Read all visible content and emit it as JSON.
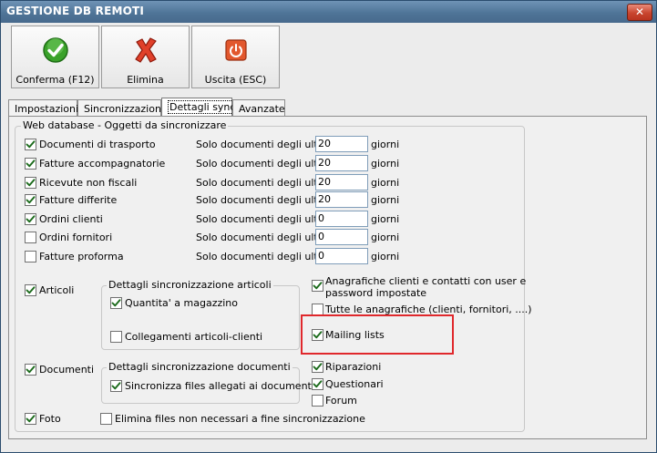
{
  "window": {
    "title": "GESTIONE DB REMOTI",
    "close_glyph": "✕"
  },
  "toolbar": [
    {
      "label": "Conferma (F12)",
      "icon": "green-check-icon"
    },
    {
      "label": "Elimina",
      "icon": "red-x-icon"
    },
    {
      "label": "Uscita (ESC)",
      "icon": "exit-power-icon"
    }
  ],
  "tabs": [
    {
      "label": "Impostazioni",
      "active": false
    },
    {
      "label": "Sincronizzazione",
      "active": false
    },
    {
      "label": "Dettagli sync",
      "active": true
    },
    {
      "label": "Avanzate",
      "active": false
    }
  ],
  "main_group": {
    "legend": "Web database - Oggetti da sincronizzare"
  },
  "doc_rows": [
    {
      "label": "Documenti di trasporto",
      "checked": true,
      "prefix": "Solo documenti degli ultimi",
      "value": "20",
      "suffix": "giorni"
    },
    {
      "label": "Fatture accompagnatorie",
      "checked": true,
      "prefix": "Solo documenti degli ultimi",
      "value": "20",
      "suffix": "giorni"
    },
    {
      "label": "Ricevute non fiscali",
      "checked": true,
      "prefix": "Solo documenti degli ultimi",
      "value": "20",
      "suffix": "giorni"
    },
    {
      "label": "Fatture differite",
      "checked": true,
      "prefix": "Solo documenti degli ultimi",
      "value": "20",
      "suffix": "giorni"
    },
    {
      "label": "Ordini clienti",
      "checked": true,
      "prefix": "Solo documenti degli ultimi",
      "value": "0",
      "suffix": "giorni"
    },
    {
      "label": "Ordini fornitori",
      "checked": false,
      "prefix": "Solo documenti degli ultimi",
      "value": "0",
      "suffix": "giorni"
    },
    {
      "label": "Fatture proforma",
      "checked": false,
      "prefix": "Solo documenti degli ultimi",
      "value": "0",
      "suffix": "giorni"
    }
  ],
  "articoli": {
    "label": "Articoli",
    "checked": true,
    "group_legend": "Dettagli sincronizzazione articoli",
    "quantita": {
      "label": "Quantita' a magazzino",
      "checked": true
    },
    "collegamenti": {
      "label": "Collegamenti articoli-clienti",
      "checked": false
    }
  },
  "anagrafiche": {
    "user": {
      "label_line1": "Anagrafiche clienti e contatti con user e",
      "label_line2": "password impostate",
      "checked": true
    },
    "tutte": {
      "label": "Tutte le anagrafiche (clienti, fornitori, ....)",
      "checked": false
    },
    "mailing": {
      "label": "Mailing lists",
      "checked": true
    }
  },
  "documenti": {
    "label": "Documenti",
    "checked": true,
    "group_legend": "Dettagli sincronizzazione documenti",
    "allegati": {
      "label": "Sincronizza files allegati ai documenti",
      "checked": true
    }
  },
  "extra": {
    "riparazioni": {
      "label": "Riparazioni",
      "checked": true
    },
    "questionari": {
      "label": "Questionari",
      "checked": true
    },
    "forum": {
      "label": "Forum",
      "checked": false
    }
  },
  "foto": {
    "label": "Foto",
    "checked": true
  },
  "elimina_files": {
    "label": "Elimina files non necessari a fine sincronizzazione",
    "checked": false
  },
  "colors": {
    "highlight_box": "#e0282c",
    "title_bar": "#4f7598"
  }
}
